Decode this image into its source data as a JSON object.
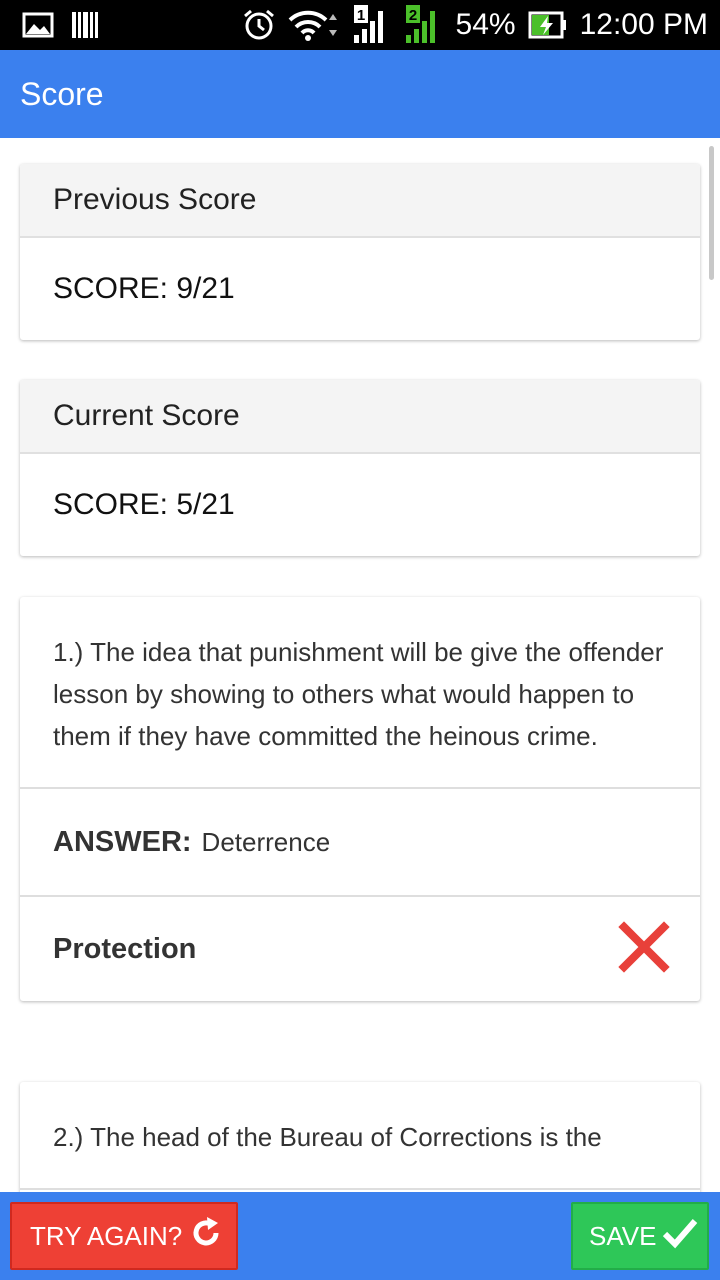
{
  "status_bar": {
    "battery": "54%",
    "time": "12:00 PM",
    "sim1": "1",
    "sim2": "2",
    "icons": [
      "gallery-icon",
      "barcode-icon",
      "alarm-icon",
      "wifi-icon",
      "signal-sim1-icon",
      "signal-sim2-icon",
      "battery-charging-icon"
    ]
  },
  "app_bar": {
    "title": "Score"
  },
  "previous_score": {
    "header": "Previous Score",
    "score": "SCORE: 9/21"
  },
  "current_score": {
    "header": "Current Score",
    "score": "SCORE: 5/21"
  },
  "questions": [
    {
      "text": "1.) The idea that punishment will be give the offender lesson by showing to others what would happen to them if they have committed the heinous crime.",
      "answer_label": "ANSWER:",
      "answer": "Deterrence",
      "user_answer": "Protection",
      "result_icon": "wrong-x-icon"
    },
    {
      "text": "2.) The head of the Bureau of Corrections is the"
    }
  ],
  "bottom_bar": {
    "try_again_label": "TRY AGAIN?",
    "save_label": "SAVE"
  },
  "colors": {
    "primary": "#3b80ee",
    "try_again": "#ee4035",
    "save": "#2ec758",
    "wrong": "#e8403a",
    "signal_green": "#4bc02a"
  }
}
